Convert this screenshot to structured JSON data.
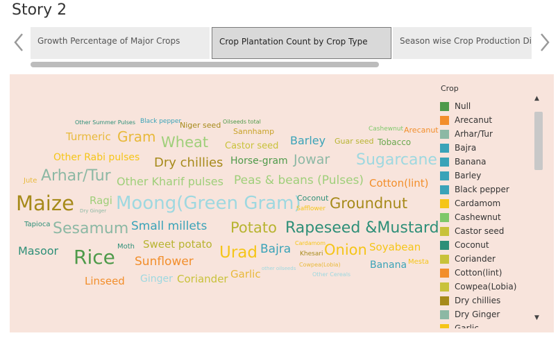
{
  "story": {
    "title": "Story 2"
  },
  "story_points": [
    {
      "label": "Growth Percentage of Major Crops"
    },
    {
      "label": "Crop Plantation Count by Crop Type"
    },
    {
      "label": "Season wise Crop Production Distribution"
    }
  ],
  "legend": {
    "title": "Crop",
    "items": [
      {
        "label": "Null",
        "color": "#4e9a4a"
      },
      {
        "label": "Arecanut",
        "color": "#f28e2b"
      },
      {
        "label": "Arhar/Tur",
        "color": "#8cb8a4"
      },
      {
        "label": "Bajra",
        "color": "#3aa3b8"
      },
      {
        "label": "Banana",
        "color": "#3aa3b8"
      },
      {
        "label": "Barley",
        "color": "#3aa3b8"
      },
      {
        "label": "Black pepper",
        "color": "#3aa3b8"
      },
      {
        "label": "Cardamom",
        "color": "#f5c518"
      },
      {
        "label": "Cashewnut",
        "color": "#7ec86a"
      },
      {
        "label": "Castor seed",
        "color": "#c8c23a"
      },
      {
        "label": "Coconut",
        "color": "#2e8f78"
      },
      {
        "label": "Coriander",
        "color": "#c8c23a"
      },
      {
        "label": "Cotton(lint)",
        "color": "#f28e2b"
      },
      {
        "label": "Cowpea(Lobia)",
        "color": "#c8c23a"
      },
      {
        "label": "Dry chillies",
        "color": "#a68a1a"
      },
      {
        "label": "Dry Ginger",
        "color": "#8cb8a4"
      },
      {
        "label": "Garlic",
        "color": "#f5c518"
      }
    ]
  },
  "words": [
    {
      "text": "Other Summer Pulses",
      "color": "#2e8f78"
    },
    {
      "text": "Black pepper",
      "color": "#3aa3b8"
    },
    {
      "text": "Niger seed",
      "color": "#a68a1a"
    },
    {
      "text": "Oilseeds total",
      "color": "#4e9a4a"
    },
    {
      "text": "Turmeric",
      "color": "#e8b93a"
    },
    {
      "text": "Gram",
      "color": "#e8b93a"
    },
    {
      "text": "Wheat",
      "color": "#9fcf7a"
    },
    {
      "text": "Sannhamp",
      "color": "#c8a32a"
    },
    {
      "text": "Castor seed",
      "color": "#c8c23a"
    },
    {
      "text": "Barley",
      "color": "#3aa3b8"
    },
    {
      "text": "Guar seed",
      "color": "#b7b430"
    },
    {
      "text": "Tobacco",
      "color": "#6aa84f"
    },
    {
      "text": "Cashewnut",
      "color": "#7ec86a"
    },
    {
      "text": "Arecanut",
      "color": "#f28e2b"
    },
    {
      "text": "Other Rabi pulses",
      "color": "#f5c518"
    },
    {
      "text": "Dry chillies",
      "color": "#a68a1a"
    },
    {
      "text": "Horse-gram",
      "color": "#4e9a4a"
    },
    {
      "text": "Jowar",
      "color": "#8cb8a4"
    },
    {
      "text": "Sugarcane",
      "color": "#9ed8e0"
    },
    {
      "text": "Jute",
      "color": "#e8b93a"
    },
    {
      "text": "Arhar/Tur",
      "color": "#8cb8a4"
    },
    {
      "text": "Ragi",
      "color": "#9fcf7a"
    },
    {
      "text": "Other Kharif pulses",
      "color": "#9fcf7a"
    },
    {
      "text": "Peas & beans (Pulses)",
      "color": "#9fcf7a"
    },
    {
      "text": "Cotton(lint)",
      "color": "#f28e2b"
    },
    {
      "text": "Maize",
      "color": "#a68a1a"
    },
    {
      "text": "Dry Ginger",
      "color": "#8cb8a4"
    },
    {
      "text": "Moong(Green Gram)",
      "color": "#9ed8e0"
    },
    {
      "text": "Coconut",
      "color": "#2e8f78"
    },
    {
      "text": "Safflower",
      "color": "#f5c518"
    },
    {
      "text": "Groundnut",
      "color": "#a68a1a"
    },
    {
      "text": "Tapioca",
      "color": "#2e8f78"
    },
    {
      "text": "Sesamum",
      "color": "#8cb8a4"
    },
    {
      "text": "Small millets",
      "color": "#3aa3b8"
    },
    {
      "text": "Potato",
      "color": "#b7b430"
    },
    {
      "text": "Rapeseed &Mustard",
      "color": "#2e8f78"
    },
    {
      "text": "Masoor",
      "color": "#2e8f78"
    },
    {
      "text": "Moth",
      "color": "#2e8f78"
    },
    {
      "text": "Sweet potato",
      "color": "#b7b430"
    },
    {
      "text": "Rice",
      "color": "#4e9a4a"
    },
    {
      "text": "Urad",
      "color": "#f5c518"
    },
    {
      "text": "Bajra",
      "color": "#3aa3b8"
    },
    {
      "text": "Cardamom",
      "color": "#f5c518"
    },
    {
      "text": "Khesari",
      "color": "#a68a1a"
    },
    {
      "text": "Onion",
      "color": "#f5c518"
    },
    {
      "text": "Soyabean",
      "color": "#f5c518"
    },
    {
      "text": "Sunflower",
      "color": "#f28e2b"
    },
    {
      "text": "Cowpea(Lobia)",
      "color": "#e8b93a"
    },
    {
      "text": "Banana",
      "color": "#3aa3b8"
    },
    {
      "text": "Mesta",
      "color": "#f5c518"
    },
    {
      "text": "other oilseeds",
      "color": "#9ed8e0"
    },
    {
      "text": "Other Cereals",
      "color": "#9ed8e0"
    },
    {
      "text": "Garlic",
      "color": "#e8b93a"
    },
    {
      "text": "Linseed",
      "color": "#f28e2b"
    },
    {
      "text": "Ginger",
      "color": "#9ed8e0"
    },
    {
      "text": "Coriander",
      "color": "#c8c23a"
    }
  ]
}
